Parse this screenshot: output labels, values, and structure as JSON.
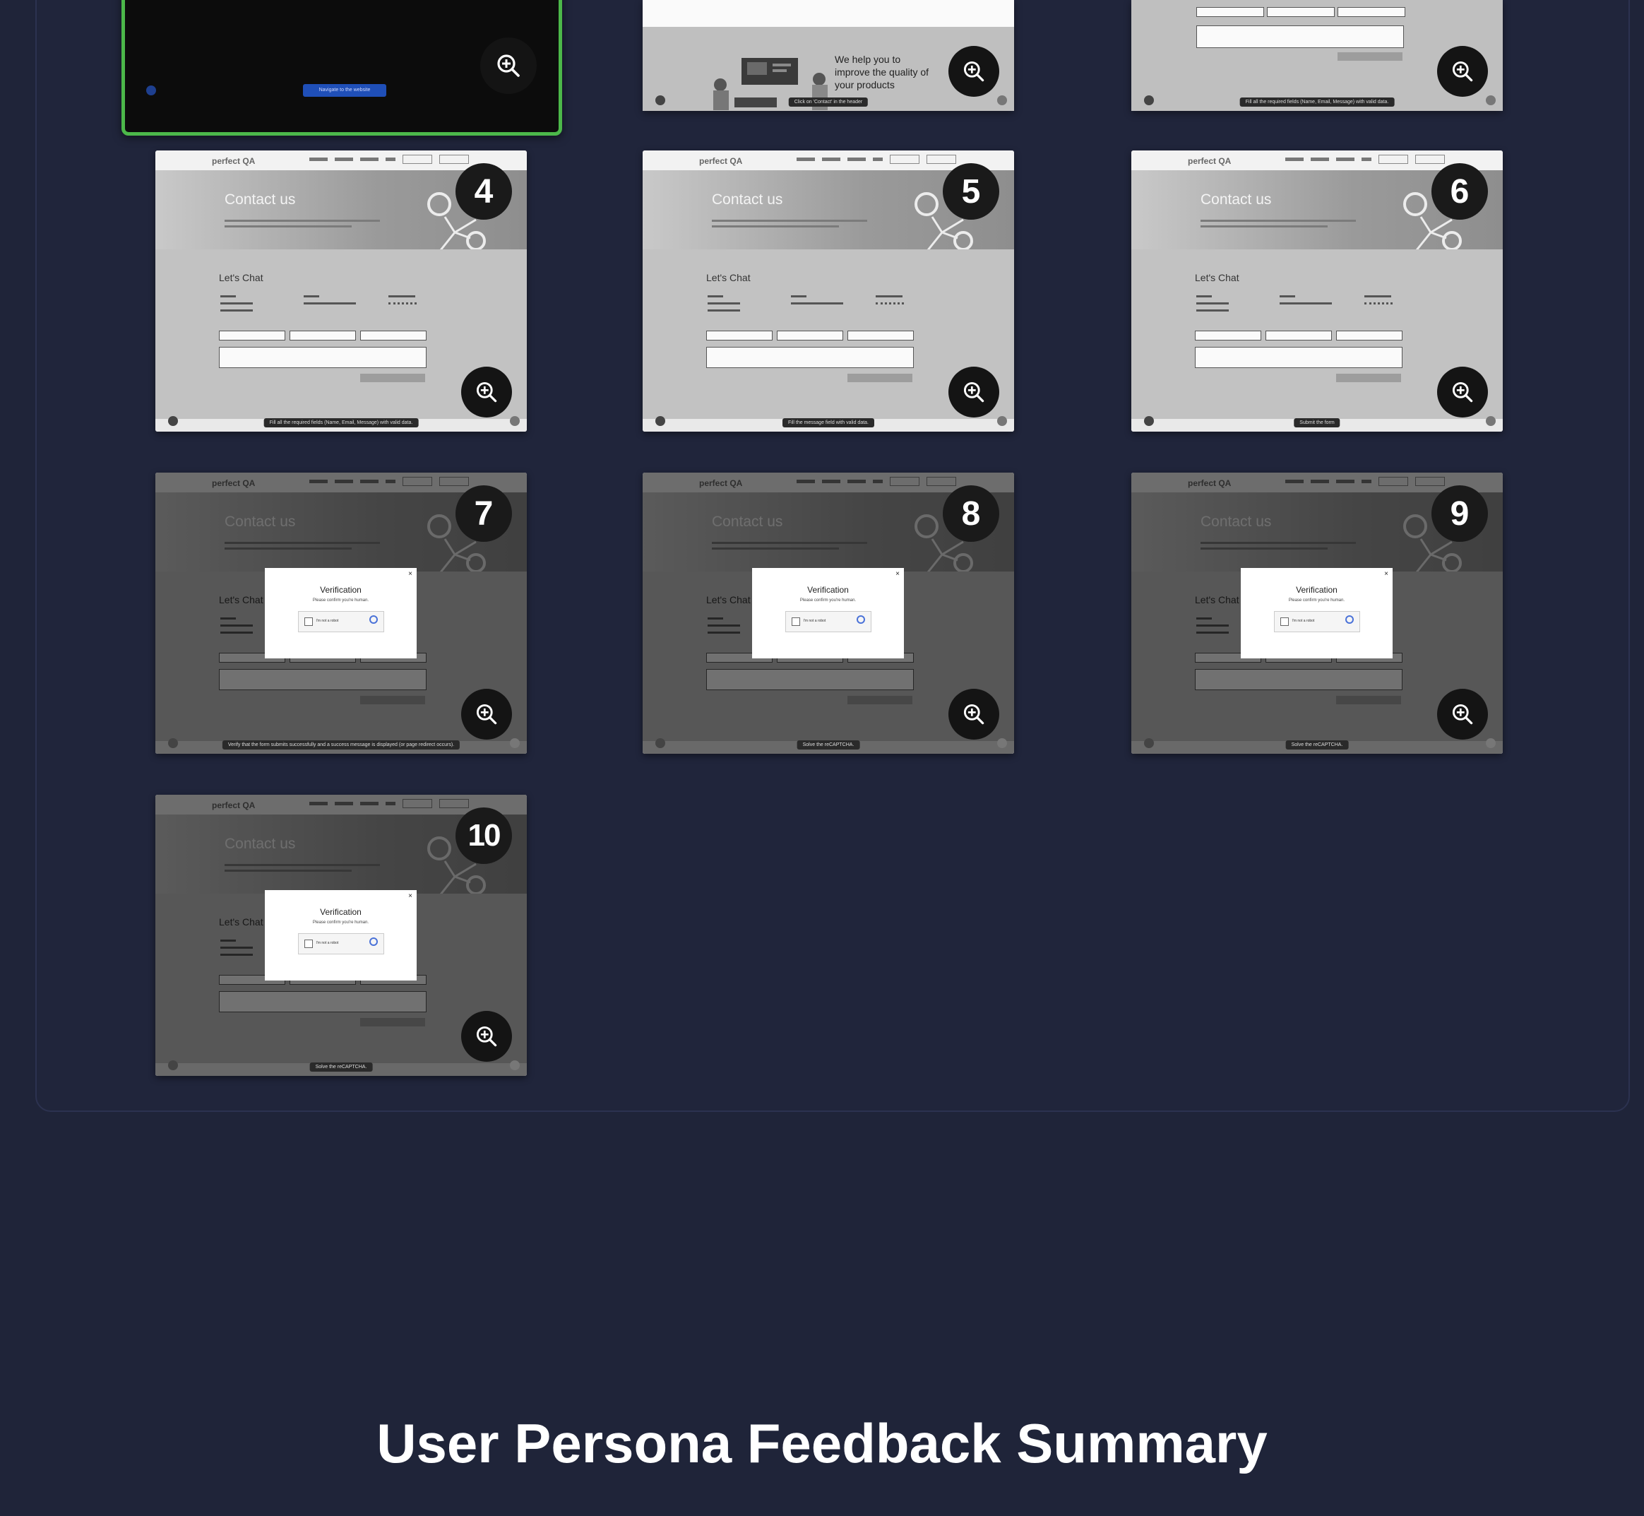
{
  "section_title": "User Persona Feedback Summary",
  "top_row": {
    "card1_button": "Navigate to the website",
    "card2_text": "We help you to improve the quality of your products",
    "card2_caption": "Click on 'Contact' in the header",
    "card3_caption": "Fill all the required fields (Name, Email, Message) with valid data."
  },
  "mock_site": {
    "logo": "perfect QA",
    "hero_title": "Contact us",
    "form_title": "Let's Chat"
  },
  "captcha": {
    "title": "Verification",
    "subtitle": "Please confirm you're human.",
    "checkbox_label": "I'm not a robot",
    "close": "×"
  },
  "steps": [
    {
      "number": "4",
      "caption": "Fill all the required fields (Name, Email, Message) with valid data."
    },
    {
      "number": "5",
      "caption": "Fill the message field with valid data."
    },
    {
      "number": "6",
      "caption": "Submit the form"
    },
    {
      "number": "7",
      "caption": "Verify that the form submits successfully and a success message is displayed (or page redirect occurs)."
    },
    {
      "number": "8",
      "caption": "Solve the reCAPTCHA."
    },
    {
      "number": "9",
      "caption": "Solve the reCAPTCHA."
    },
    {
      "number": "10",
      "caption": "Solve the reCAPTCHA."
    }
  ]
}
